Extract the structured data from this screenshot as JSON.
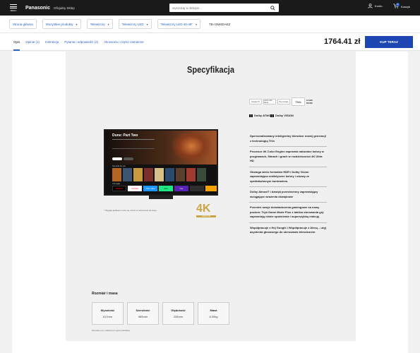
{
  "header": {
    "menu_label": "MENU",
    "brand": "Panasonic",
    "store_label": "Oficjalny Sklep",
    "search_placeholder": "wyszukaj w sklepie...",
    "account_label": "Konto",
    "cart_label": "Koszyk",
    "cart_count": "0"
  },
  "breadcrumbs": [
    {
      "label": "Strona główna"
    },
    {
      "label": "Wszystkie produkty"
    },
    {
      "label": "Telewizory"
    },
    {
      "label": "Telewizory LED"
    },
    {
      "label": "Telewizory LED 40-49\""
    },
    {
      "label": "TB-43W60AEZ"
    }
  ],
  "tabs": [
    {
      "label": "Opis"
    },
    {
      "label": "Opinie (1)"
    },
    {
      "label": "Instrukcja"
    },
    {
      "label": "Pytania i odpowiedzi (2)"
    },
    {
      "label": "Akcesoria i części zamienne"
    }
  ],
  "price": "1764.41 zł",
  "buy_label": "KUP TERAZ",
  "spec": {
    "title": "Specyfikacja",
    "logos": {
      "google": "Google TV",
      "alexa": "works with alexa",
      "hey_google": "Hey Google",
      "tivo": "TiVo",
      "game_mode": "GAME MODE",
      "dolby_atmos": "Dolby ATMOS",
      "dolby_vision": "Dolby VISION"
    },
    "tv_note": "* Wygląd aplikacji może się różnić w zależności od kraju.",
    "tv_screen": {
      "title": "Dune: Part Two",
      "row1_label": "Top picks for you",
      "row2_label": "Your apps",
      "apps": [
        "NETFLIX",
        "YouTube",
        "prime video",
        "hulu",
        "max"
      ]
    },
    "k4": {
      "mark": "4K",
      "sub": "ULTRA HD"
    },
    "features": [
      "Spersonalizowany inteligentny telewizor nowej generacji z technologią TiVo",
      "Procesor 4K Color Engine zapewnia naturalne kolory w programach, filmach i grach w rozdzielczości 4K Ultra HD",
      "Obsługa wielu formatów HDR i Dolby Vision zapewniająca realistyczne kolory i obrazy ze spektakularnym kontrastem.",
      "Dolby Atmos® i dźwięk przestrzenny zapewniający wciągające wrażenia dźwiękowe",
      "Przenieś swoje doświadczenia gamingowe na nowy poziom: Tryb Game Mode Plus z tablica sterowania gry zapewniają niskie opóźnienia i supersz­ybką reakcję",
      "Współpracuje z Hej Google i Współpracuje z Alexą – użyj asystenta głosowego do sterowania telewizorem"
    ],
    "sizes_title": "Rozmiar i masa",
    "sizes": [
      {
        "label": "Wysokość",
        "value": "617mm"
      },
      {
        "label": "Szerokość",
        "value": "965mm"
      },
      {
        "label": "Głębokość",
        "value": "235mm"
      },
      {
        "label": "Masa",
        "value": "8.00kg"
      }
    ],
    "sizes_note": "Wymiary przy założonym typie podstawy"
  }
}
